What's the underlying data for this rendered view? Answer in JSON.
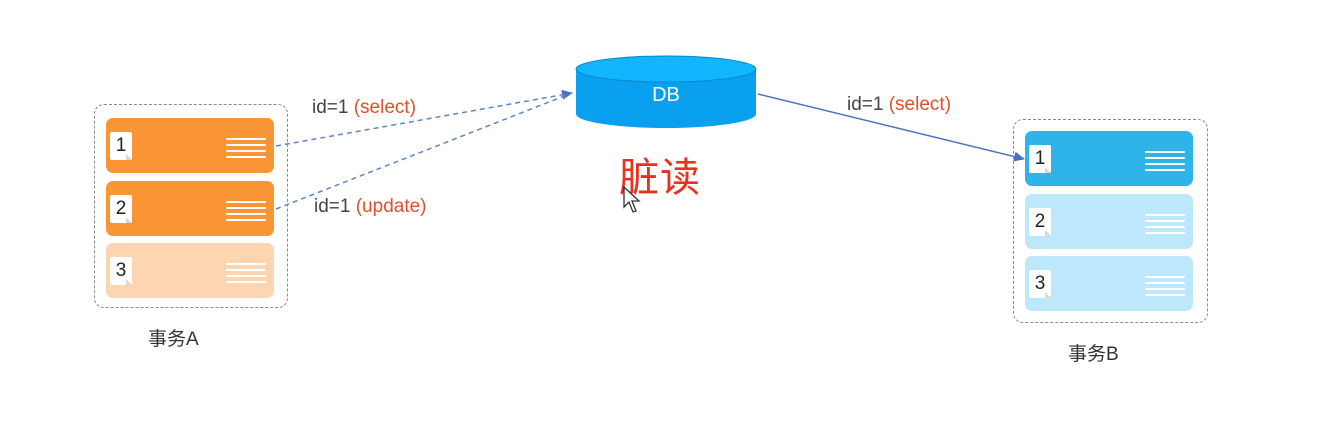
{
  "diagram": {
    "title": "脏读",
    "db_label": "DB",
    "transaction_a": {
      "label": "事务A",
      "rows": [
        {
          "num": "1",
          "state": "active"
        },
        {
          "num": "2",
          "state": "active"
        },
        {
          "num": "3",
          "state": "faded"
        }
      ]
    },
    "transaction_b": {
      "label": "事务B",
      "rows": [
        {
          "num": "1",
          "state": "active"
        },
        {
          "num": "2",
          "state": "faded"
        },
        {
          "num": "3",
          "state": "faded"
        }
      ]
    },
    "edges": {
      "a_select": {
        "prefix": "id=1 ",
        "op": "(select)"
      },
      "a_update": {
        "prefix": "id=1 ",
        "op": "(update)"
      },
      "b_select": {
        "prefix": "id=1 ",
        "op": "(select)"
      }
    },
    "colors": {
      "orange": "#f99534",
      "orange_light": "#fdd5b0",
      "blue": "#2fb4ea",
      "blue_light": "#bde8fb",
      "db": "#0aa0f0",
      "title": "#e8321f",
      "op_text": "#e0502a",
      "arrow": "#4a72c4"
    },
    "icons": [
      "row-lines-icon",
      "db-cylinder-icon",
      "mouse-cursor-icon"
    ]
  }
}
